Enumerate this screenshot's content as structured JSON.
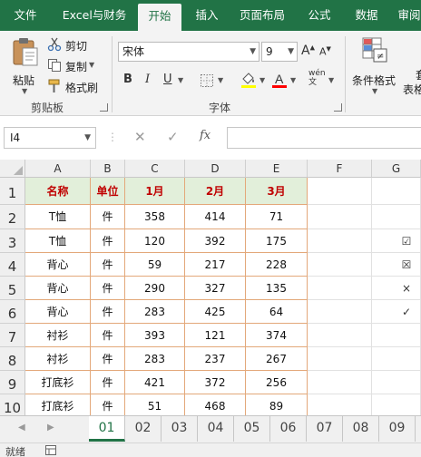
{
  "tabs": [
    {
      "label": "文件",
      "active": false
    },
    {
      "label": "Excel与财务",
      "active": false
    },
    {
      "label": "开始",
      "active": true
    },
    {
      "label": "插入",
      "active": false
    },
    {
      "label": "页面布局",
      "active": false
    },
    {
      "label": "公式",
      "active": false
    },
    {
      "label": "数据",
      "active": false
    },
    {
      "label": "审阅",
      "active": false
    }
  ],
  "ribbon": {
    "paste": "粘贴",
    "cut": "剪切",
    "copy": "复制",
    "format_painter": "格式刷",
    "clipboard_group": "剪贴板",
    "font_name": "宋体",
    "font_size": "9",
    "bold": "B",
    "italic": "I",
    "underline": "U",
    "font_group": "字体",
    "cond_format": "条件格式",
    "table_format_partial": "表格",
    "table_format_top": "套"
  },
  "formula_bar": {
    "name_box": "I4",
    "fx": "fx",
    "value": ""
  },
  "sheet": {
    "columns": [
      "A",
      "B",
      "C",
      "D",
      "E",
      "F",
      "G"
    ],
    "rows": [
      "1",
      "2",
      "3",
      "4",
      "5",
      "6",
      "7",
      "8",
      "9",
      "10"
    ],
    "header": [
      "名称",
      "单位",
      "1月",
      "2月",
      "3月"
    ],
    "data": [
      [
        "T恤",
        "件",
        "358",
        "414",
        "71"
      ],
      [
        "T恤",
        "件",
        "120",
        "392",
        "175"
      ],
      [
        "背心",
        "件",
        "59",
        "217",
        "228"
      ],
      [
        "背心",
        "件",
        "290",
        "327",
        "135"
      ],
      [
        "背心",
        "件",
        "283",
        "425",
        "64"
      ],
      [
        "衬衫",
        "件",
        "393",
        "121",
        "374"
      ],
      [
        "衬衫",
        "件",
        "283",
        "237",
        "267"
      ],
      [
        "打底衫",
        "件",
        "421",
        "372",
        "256"
      ],
      [
        "打底衫",
        "件",
        "51",
        "468",
        "89"
      ]
    ],
    "g_symbols": [
      "☑",
      "☒",
      "×",
      "✓"
    ]
  },
  "sheet_tabs": [
    "01",
    "02",
    "03",
    "04",
    "05",
    "06",
    "07",
    "08",
    "09"
  ],
  "active_sheet": "01",
  "status": {
    "ready": "就绪"
  },
  "colors": {
    "brand": "#217346",
    "header_fill": "#e2efda",
    "header_text": "#c00000",
    "table_border": "#e3a87a"
  }
}
